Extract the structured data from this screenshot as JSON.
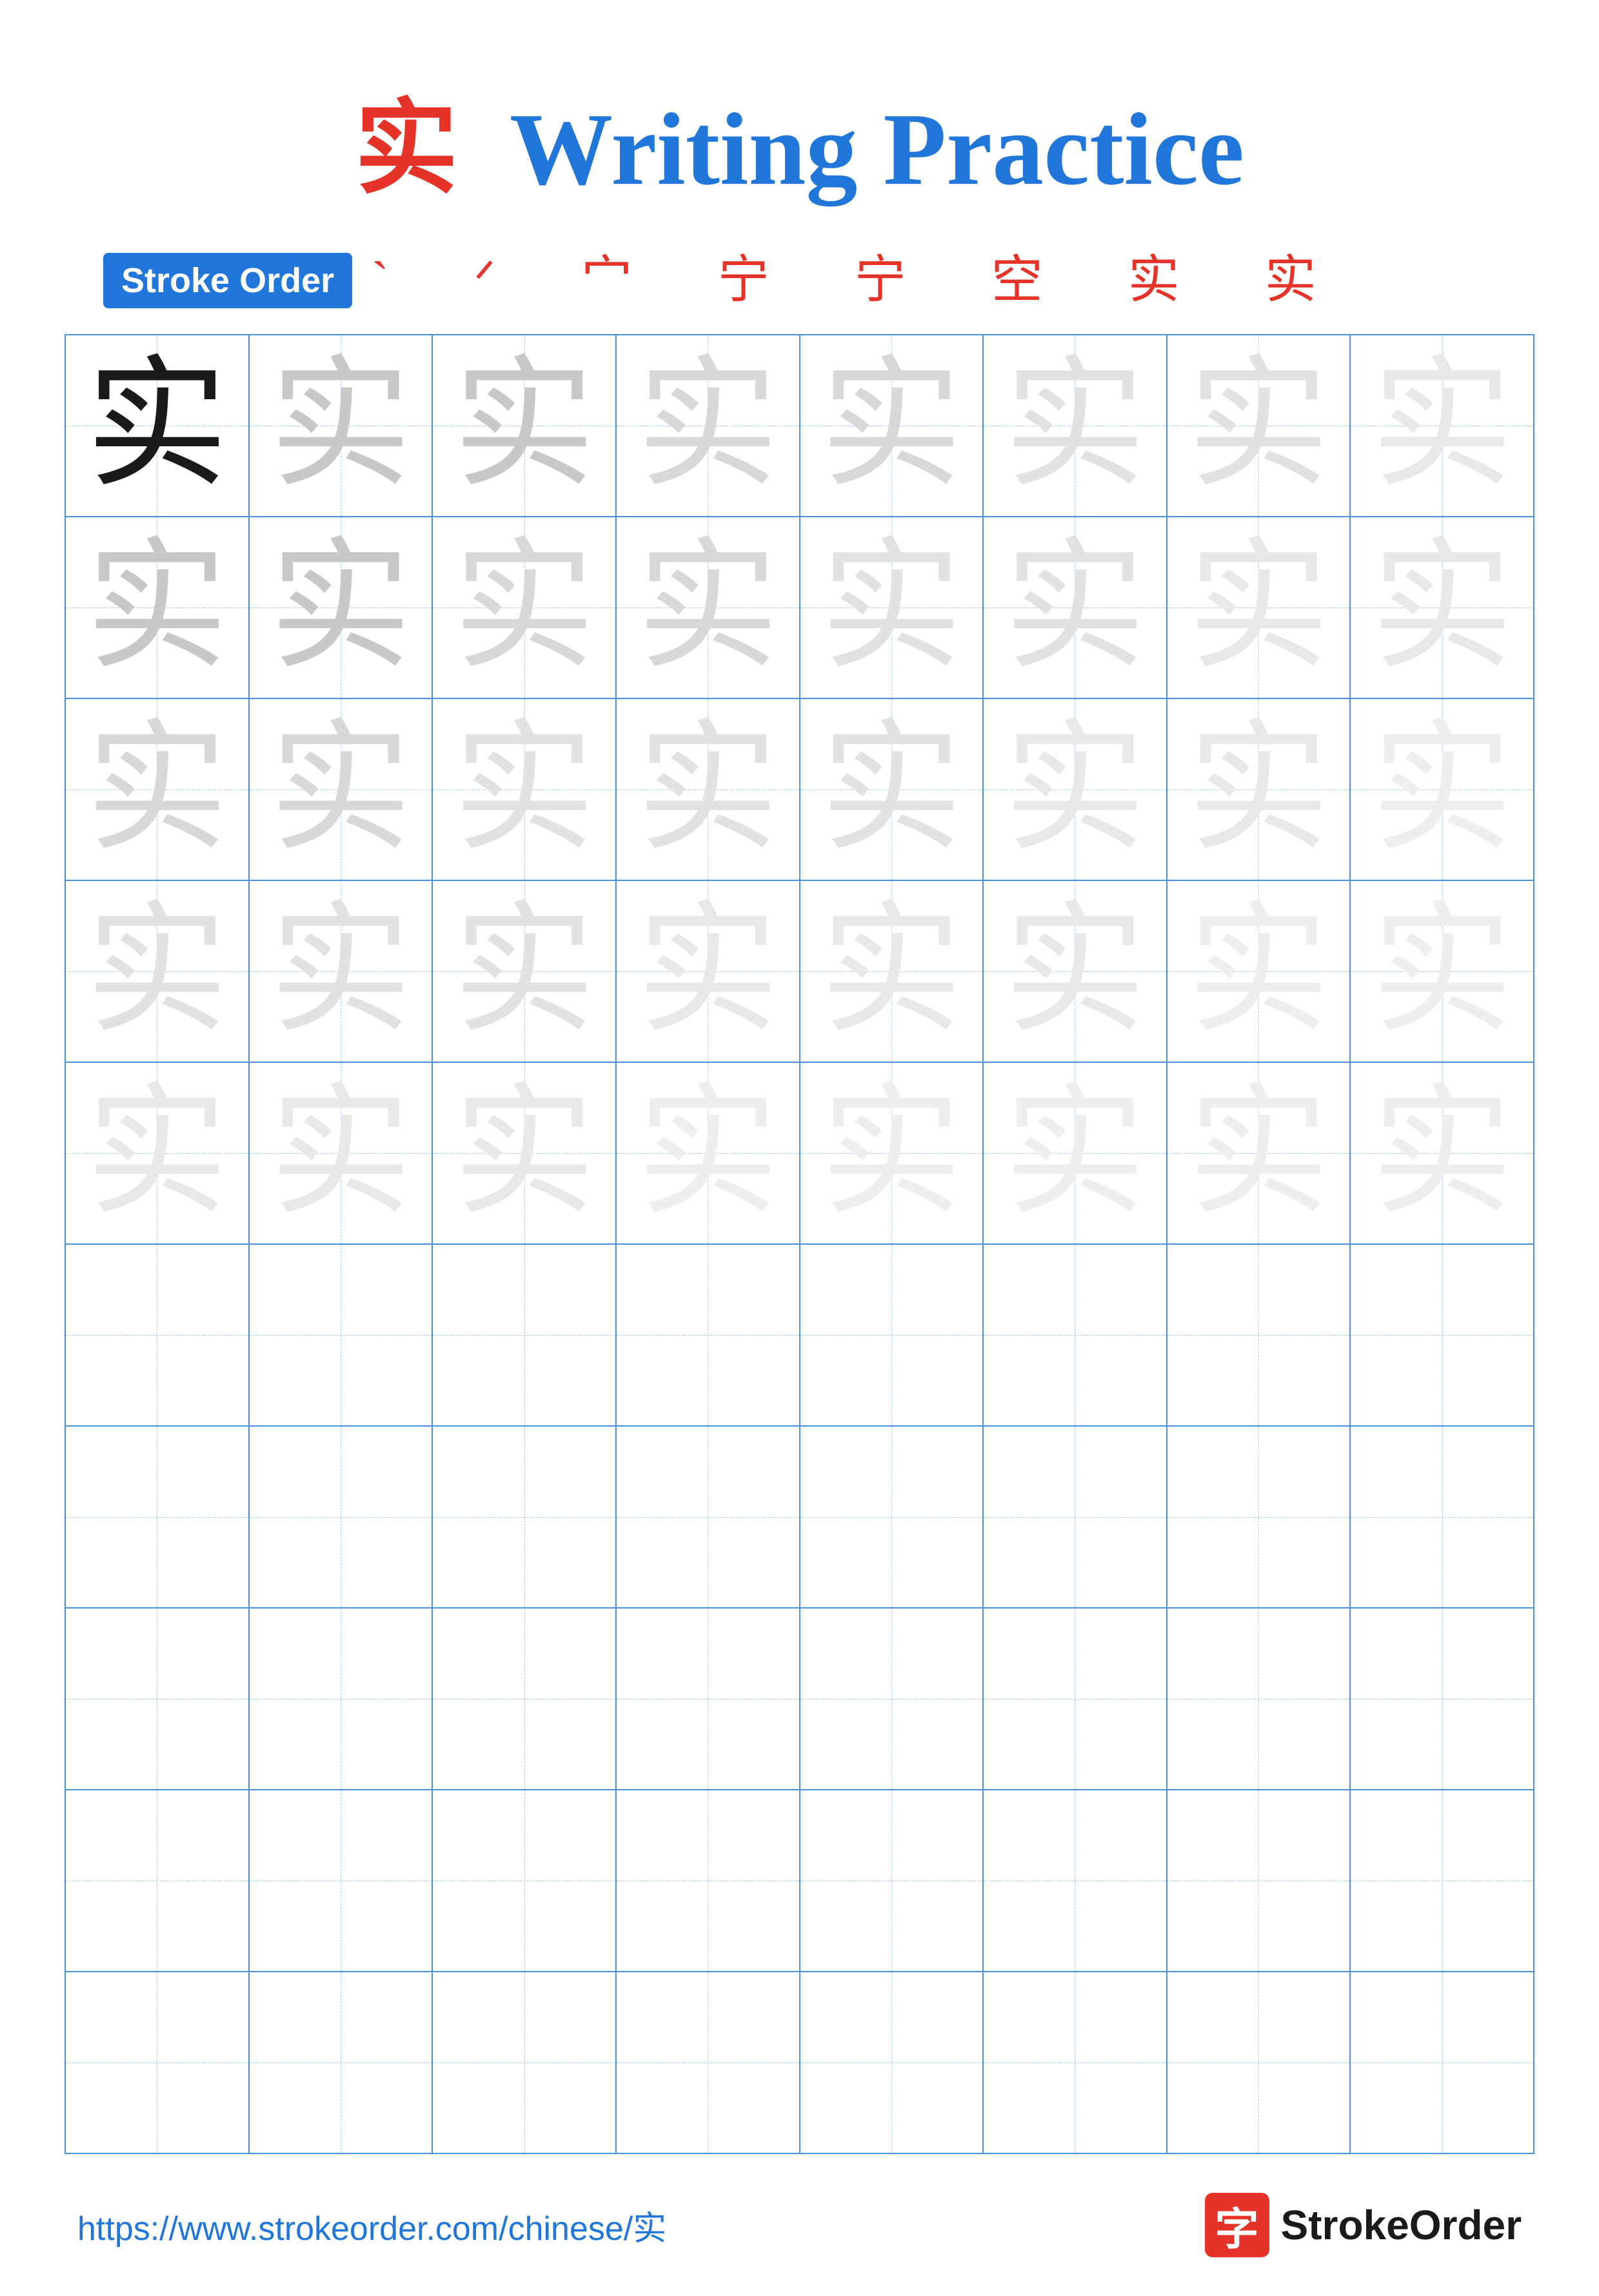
{
  "title": {
    "char": "实",
    "text": "Writing Practice"
  },
  "stroke_order": {
    "badge_label": "Stroke Order",
    "chars": "` ᐟ 宀 宁 宁 空 实 实"
  },
  "grid": {
    "rows": 10,
    "cols": 8,
    "character": "实",
    "practice_rows": 5,
    "empty_rows": 5
  },
  "footer": {
    "url": "https://www.strokeorder.com/chinese/实",
    "brand_char": "字",
    "brand_name": "StrokeOrder"
  }
}
